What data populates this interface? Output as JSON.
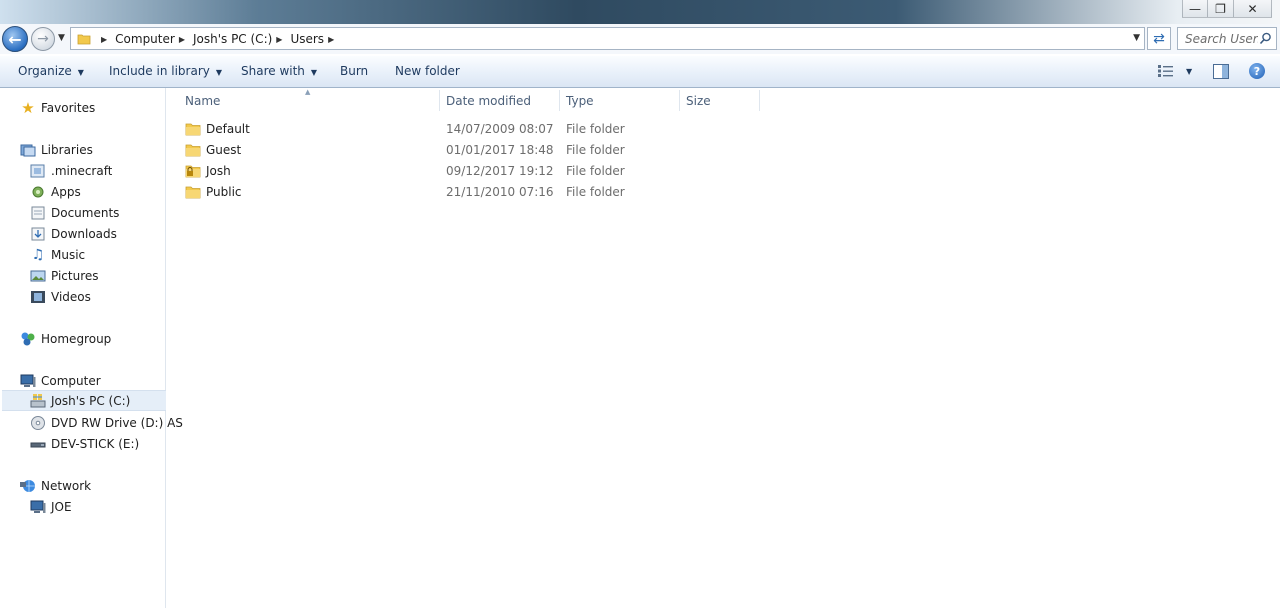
{
  "window": {
    "minimize_icon": "minimize-icon",
    "maximize_icon": "maximize-icon",
    "close_icon": "close-icon"
  },
  "address": {
    "crumbs": [
      "Computer",
      "Josh's PC (C:)",
      "Users"
    ],
    "search_placeholder": "Search Users"
  },
  "toolbar": {
    "organize": "Organize",
    "include_in_library": "Include in library",
    "share_with": "Share with",
    "burn": "Burn",
    "new_folder": "New folder"
  },
  "nav": {
    "favorites": "Favorites",
    "libraries": "Libraries",
    "library_items": [
      ".minecraft",
      "Apps",
      "Documents",
      "Downloads",
      "Music",
      "Pictures",
      "Videos"
    ],
    "homegroup": "Homegroup",
    "computer": "Computer",
    "computer_items": [
      "Josh's PC (C:)",
      "DVD RW Drive (D:) AS",
      "DEV-STICK (E:)"
    ],
    "network": "Network",
    "network_items": [
      "JOE"
    ]
  },
  "columns": {
    "name": "Name",
    "date_modified": "Date modified",
    "type": "Type",
    "size": "Size"
  },
  "files": [
    {
      "name": "Default",
      "date": "14/07/2009 08:07",
      "type": "File folder"
    },
    {
      "name": "Guest",
      "date": "01/01/2017 18:48",
      "type": "File folder"
    },
    {
      "name": "Josh",
      "date": "09/12/2017 19:12",
      "type": "File folder"
    },
    {
      "name": "Public",
      "date": "21/11/2010 07:16",
      "type": "File folder"
    }
  ],
  "colors": {
    "folder": "#f2c94c",
    "accent": "#2b6fc2",
    "selection": "#e5eef8"
  }
}
